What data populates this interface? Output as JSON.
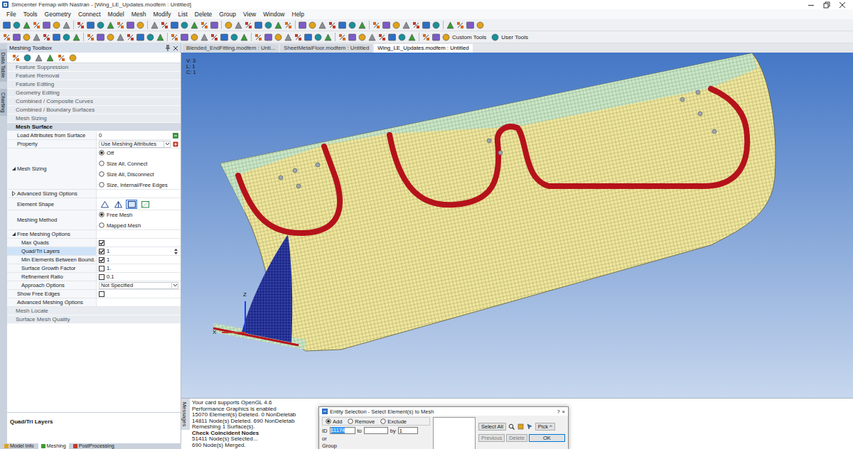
{
  "window": {
    "title": "Simcenter Femap with Nastran - [Wing_LE_Updates.modfem : Untitled]"
  },
  "menu": [
    "File",
    "Tools",
    "Geometry",
    "Connect",
    "Model",
    "Mesh",
    "Modify",
    "List",
    "Delete",
    "Group",
    "View",
    "Window",
    "Help"
  ],
  "toolbar": {
    "custom_tools": "Custom Tools",
    "user_tools": "User Tools"
  },
  "side_tabs": [
    {
      "label": "Data Table",
      "selected": false
    },
    {
      "label": "Charting",
      "selected": false
    }
  ],
  "toolbox": {
    "title": "Meshing Toolbox",
    "sections_above": [
      "Feature Suppression",
      "Feature Removal",
      "Feature Editing",
      "Geometry Editing",
      "Combined / Composite Curves",
      "Combined / Boundary Surfaces",
      "Mesh Sizing"
    ],
    "active_section": "Mesh Surface",
    "properties": [
      {
        "kind": "value",
        "label": "Load Attributes from Surface",
        "value": "0",
        "expander": "none",
        "selected": false
      },
      {
        "kind": "dropdown",
        "label": "Property",
        "value": "Use Meshing Attributes",
        "expander": "none",
        "selected": false
      },
      {
        "kind": "radio",
        "label": "Mesh Sizing",
        "expander": "open",
        "selected": false,
        "options": [
          {
            "label": "Off",
            "selected": true
          },
          {
            "label": "Size All, Connect",
            "selected": false
          },
          {
            "label": "Size All, Disconnect",
            "selected": false
          },
          {
            "label": "Size, Internal/Free Edges",
            "selected": false
          }
        ]
      },
      {
        "kind": "group",
        "label": "Advanced Sizing Options",
        "expander": "closed",
        "selected": false,
        "children": []
      },
      {
        "kind": "shape",
        "label": "Element Shape",
        "expander": "none",
        "selected": false,
        "options": [
          {
            "kind": "tri",
            "selected": false
          },
          {
            "kind": "tri-mixed",
            "selected": false
          },
          {
            "kind": "quad",
            "selected": true
          },
          {
            "kind": "quad-mixed",
            "selected": false
          }
        ]
      },
      {
        "kind": "radio",
        "label": "Meshing Method",
        "expander": "none",
        "selected": false,
        "options": [
          {
            "label": "Free Mesh",
            "selected": true
          },
          {
            "label": "Mapped Mesh",
            "selected": false
          }
        ]
      },
      {
        "kind": "group",
        "label": "Free Meshing Options",
        "expander": "open",
        "selected": false,
        "children": [
          {
            "kind": "check",
            "label": "Max Quads",
            "checked": true,
            "expander": "none",
            "selected": false
          },
          {
            "kind": "spin",
            "label": "Quad/Tri Layers",
            "checked": true,
            "value": "1",
            "expander": "none",
            "selected": true
          },
          {
            "kind": "check",
            "label": "Min Elements Between Bound.",
            "checked": true,
            "value": "1",
            "expander": "none",
            "selected": false
          },
          {
            "kind": "check",
            "label": "Surface Growth Factor",
            "checked": false,
            "value": "1.",
            "expander": "none",
            "selected": false
          },
          {
            "kind": "check",
            "label": "Refinement Ratio",
            "checked": false,
            "value": "0.1",
            "expander": "none",
            "selected": false
          },
          {
            "kind": "dropdown",
            "label": "Approach Options",
            "value": "Not Specified",
            "expander": "none",
            "selected": false
          }
        ]
      },
      {
        "kind": "check",
        "label": "Show Free Edges",
        "checked": false,
        "expander": "none",
        "selected": false
      },
      {
        "kind": "group",
        "label": "Advanced Meshing Options",
        "expander": "none",
        "selected": false,
        "children": []
      }
    ],
    "sections_below": [
      "Mesh Locate",
      "Surface Mesh Quality"
    ],
    "description": "Quad/Tri Layers"
  },
  "doc_tabs": [
    {
      "label": "Blended_EndFitting.modfem : Unti...",
      "selected": false
    },
    {
      "label": "SheetMetalFloor.modfem : Untitled",
      "selected": false
    },
    {
      "label": "Wing_LE_Updates.modfem : Untitled",
      "selected": true
    }
  ],
  "viewport": {
    "counters": [
      "V: 3",
      "L: 1",
      "C: 1"
    ],
    "axes": [
      "Z",
      "X"
    ]
  },
  "messages": {
    "label": "Messages",
    "lines": [
      {
        "text": "Your card supports OpenGL 4.6",
        "bold": false
      },
      {
        "text": "Performance Graphics is enabled",
        "bold": false
      },
      {
        "text": "15070 Element(s) Deleted. 0 NonDeletab",
        "bold": false
      },
      {
        "text": "14811 Node(s) Deleted. 690 NonDeletab",
        "bold": false
      },
      {
        "text": "Remeshing 1 Surface(s).",
        "bold": false
      },
      {
        "text": "Check Coincident Nodes",
        "bold": true
      },
      {
        "text": "51411 Node(s) Selected...",
        "bold": false
      },
      {
        "text": "690 Node(s) Merged.",
        "bold": false
      }
    ]
  },
  "dialog": {
    "title": "Entity Selection - Select Element(s) to Mesh",
    "help": "?",
    "close": "×",
    "modes": [
      {
        "label": "Add",
        "selected": true
      },
      {
        "label": "Remove",
        "selected": false
      },
      {
        "label": "Exclude",
        "selected": false
      }
    ],
    "id_label": "ID",
    "id_value": "11174",
    "to_label": "to",
    "to_value": "",
    "by_label": "by",
    "by_value": "1",
    "or_label": "or",
    "group_label": "Group",
    "buttons": [
      {
        "label": "Select All",
        "disabled": false
      },
      {
        "label": "Pick ^",
        "disabled": false
      },
      {
        "label": "Previous",
        "disabled": true
      },
      {
        "label": "Delete",
        "disabled": true
      },
      {
        "label": "OK",
        "disabled": false
      }
    ]
  },
  "bottom_tabs": [
    {
      "label": "Model Info",
      "selected": false
    },
    {
      "label": "Meshing",
      "selected": true
    },
    {
      "label": "PostProcessing",
      "selected": false
    }
  ]
}
